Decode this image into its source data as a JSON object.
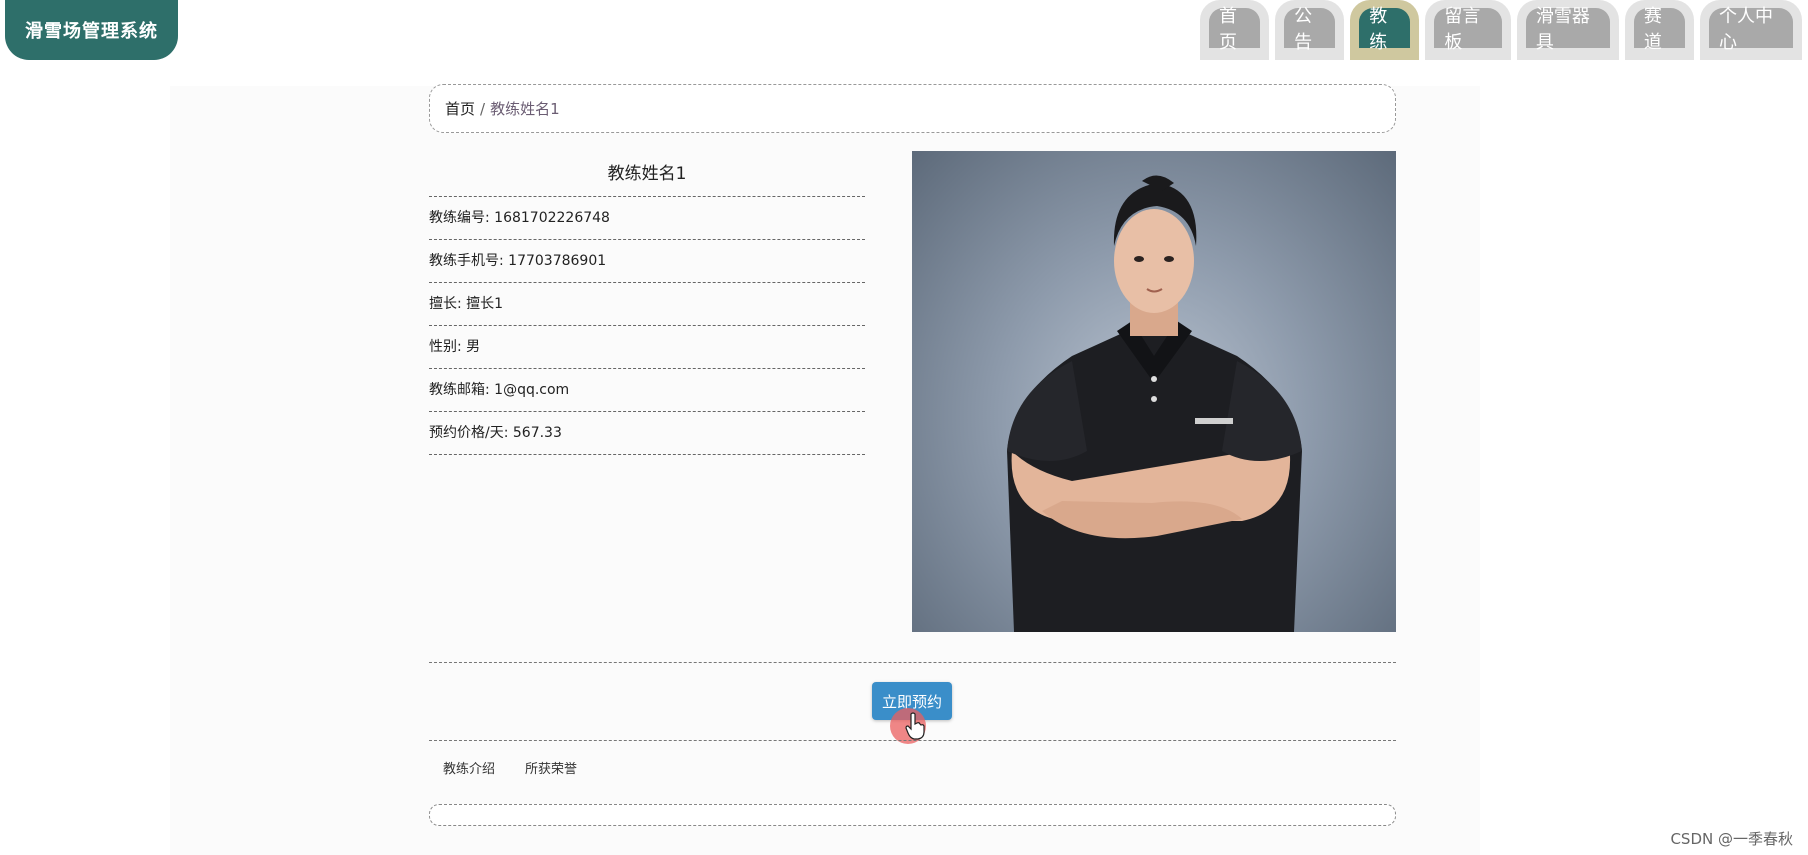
{
  "app": {
    "title": "滑雪场管理系统"
  },
  "nav": {
    "items": [
      {
        "label": "首页",
        "active": false
      },
      {
        "label": "公告",
        "active": false
      },
      {
        "label": "教练",
        "active": true
      },
      {
        "label": "留言板",
        "active": false
      },
      {
        "label": "滑雪器具",
        "active": false
      },
      {
        "label": "赛道",
        "active": false
      },
      {
        "label": "个人中心",
        "active": false
      }
    ]
  },
  "breadcrumb": {
    "home": "首页",
    "separator": "/",
    "current": "教练姓名1"
  },
  "coach": {
    "name": "教练姓名1",
    "fields": [
      {
        "label": "教练编号: 1681702226748"
      },
      {
        "label": "教练手机号: 17703786901"
      },
      {
        "label": "擅长: 擅长1"
      },
      {
        "label": "性别: 男"
      },
      {
        "label": "教练邮箱: 1@qq.com"
      },
      {
        "label": "预约价格/天: 567.33"
      }
    ]
  },
  "actions": {
    "book_label": "立即预约"
  },
  "subtabs": [
    {
      "label": "教练介绍"
    },
    {
      "label": "所获荣誉"
    }
  ],
  "watermark": "CSDN @一季春秋",
  "colors": {
    "brand": "#2e6f6a",
    "nav_tab": "#a9a9a9",
    "active_tab_border": "#cfc89f",
    "button": "#3a8ec9"
  }
}
